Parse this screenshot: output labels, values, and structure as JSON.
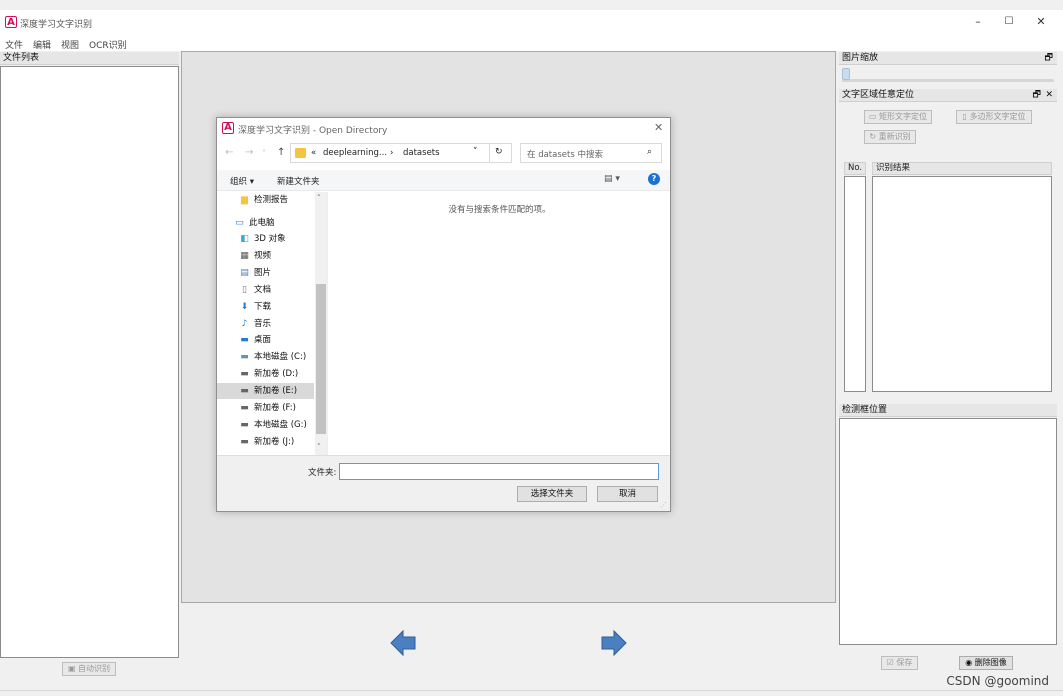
{
  "app": {
    "title": "深度学习文字识别",
    "logo_text": "A"
  },
  "window_controls": {
    "minimize": "–",
    "maximize": "☐",
    "close": "✕"
  },
  "menu": [
    "文件",
    "编辑",
    "视图",
    "OCR识别"
  ],
  "left_panel": {
    "title": "文件列表",
    "auto_button": "自动识别"
  },
  "right_panel": {
    "zoom_title": "图片缩放",
    "locate_title": "文字区域任意定位",
    "rect_button": "矩形文字定位",
    "poly_button": "多边形文字定位",
    "re_recognize_button": "重新识别",
    "table_headers": [
      "No.",
      "识别结果"
    ],
    "bbox_title": "检测框位置",
    "save_button": "保存",
    "delete_button": "删除图像",
    "dock_float": "🗗",
    "dock_close": "✕"
  },
  "dialog": {
    "title": "深度学习文字识别 - Open Directory",
    "logo_text": "A",
    "breadcrumb": [
      "deeplearning...",
      "datasets"
    ],
    "breadcrumb_prefix": "«",
    "search_placeholder": "在 datasets 中搜索",
    "organize": "组织 ▾",
    "new_folder": "新建文件夹",
    "empty_message": "没有与搜索条件匹配的项。",
    "nav_items": [
      {
        "label": "检测报告",
        "icon": "folder-icon",
        "glyph": "▆"
      },
      {
        "label": "此电脑",
        "icon": "computer-icon",
        "glyph": "▭"
      },
      {
        "label": "3D 对象",
        "icon": "cube-icon",
        "glyph": "◧"
      },
      {
        "label": "视频",
        "icon": "video-icon",
        "glyph": "▦"
      },
      {
        "label": "图片",
        "icon": "picture-icon",
        "glyph": "▤"
      },
      {
        "label": "文档",
        "icon": "document-icon",
        "glyph": "▯"
      },
      {
        "label": "下载",
        "icon": "download-icon",
        "glyph": "⬇"
      },
      {
        "label": "音乐",
        "icon": "music-icon",
        "glyph": "♪"
      },
      {
        "label": "桌面",
        "icon": "desktop-icon",
        "glyph": "▬"
      },
      {
        "label": "本地磁盘 (C:)",
        "icon": "drive-icon",
        "glyph": "▬"
      },
      {
        "label": "新加卷 (D:)",
        "icon": "drive-icon",
        "glyph": "▬"
      },
      {
        "label": "新加卷 (E:)",
        "icon": "drive-icon",
        "glyph": "▬"
      },
      {
        "label": "新加卷 (F:)",
        "icon": "drive-icon",
        "glyph": "▬"
      },
      {
        "label": "本地磁盘 (G:)",
        "icon": "drive-icon",
        "glyph": "▬"
      },
      {
        "label": "新加卷 (J:)",
        "icon": "drive-icon",
        "glyph": "▬"
      }
    ],
    "selected_nav": "新加卷 (E:)",
    "folder_label": "文件夹:",
    "folder_value": "",
    "select_button": "选择文件夹",
    "cancel_button": "取消"
  },
  "watermark": "CSDN @goomind",
  "colors": {
    "accent": "#d0105a",
    "arrow": "#4a7fc1",
    "selection": "#cce8ff",
    "nav_selected": "#d9d9d9"
  }
}
